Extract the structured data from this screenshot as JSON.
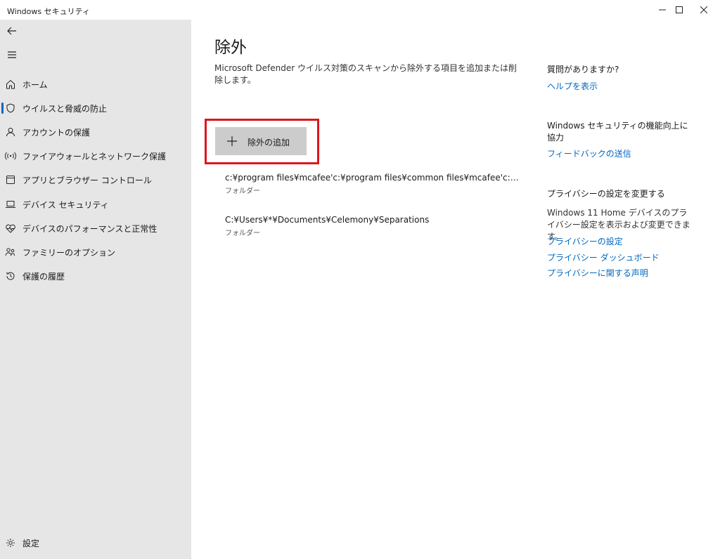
{
  "window": {
    "title": "Windows セキュリティ",
    "controls": [
      "minimize-icon",
      "maximize-icon",
      "close-icon"
    ]
  },
  "sidebar": {
    "top_icons": [
      "back-arrow-icon",
      "hamburger-menu-icon"
    ],
    "items": [
      {
        "label": "ホーム",
        "icon": "home-icon",
        "active": false
      },
      {
        "label": "ウイルスと脅威の防止",
        "icon": "shield-icon",
        "active": true
      },
      {
        "label": "アカウントの保護",
        "icon": "person-icon",
        "active": false
      },
      {
        "label": "ファイアウォールとネットワーク保護",
        "icon": "wifi-signal-icon",
        "active": false
      },
      {
        "label": "アプリとブラウザー コントロール",
        "icon": "app-window-icon",
        "active": false
      },
      {
        "label": "デバイス セキュリティ",
        "icon": "laptop-icon",
        "active": false
      },
      {
        "label": "デバイスのパフォーマンスと正常性",
        "icon": "heart-pulse-icon",
        "active": false
      },
      {
        "label": "ファミリーのオプション",
        "icon": "family-icon",
        "active": false
      },
      {
        "label": "保護の履歴",
        "icon": "history-icon",
        "active": false
      }
    ],
    "settings": {
      "label": "設定",
      "icon": "gear-icon"
    }
  },
  "main": {
    "title": "除外",
    "description": "Microsoft Defender ウイルス対策のスキャンから除外する項目を追加または削除します。",
    "add_button": {
      "label": "除外の追加",
      "icon": "plus-icon"
    },
    "highlight_color": "#e0141e",
    "exclusions": [
      {
        "path": "c:¥program files¥mcafee'c:¥program files¥common files¥mcafee'c:¥pr...",
        "type": "フォルダー"
      },
      {
        "path": "C:¥Users¥*¥Documents¥Celemony¥Separations",
        "type": "フォルダー"
      }
    ]
  },
  "side_panel": {
    "questions": {
      "heading": "質問がありますか?",
      "link": "ヘルプを表示"
    },
    "improve": {
      "heading": "Windows セキュリティの機能向上に協力",
      "link": "フィードバックの送信"
    },
    "privacy": {
      "heading": "プライバシーの設定を変更する",
      "text": "Windows 11 Home デバイスのプライバシー設定を表示および変更できます。",
      "links": [
        "プライバシーの設定",
        "プライバシー ダッシュボード",
        "プライバシーに関する声明"
      ]
    }
  },
  "colors": {
    "accent": "#0067c0",
    "sidebar_bg": "#e6e6e6",
    "button_bg": "#cccccc"
  }
}
